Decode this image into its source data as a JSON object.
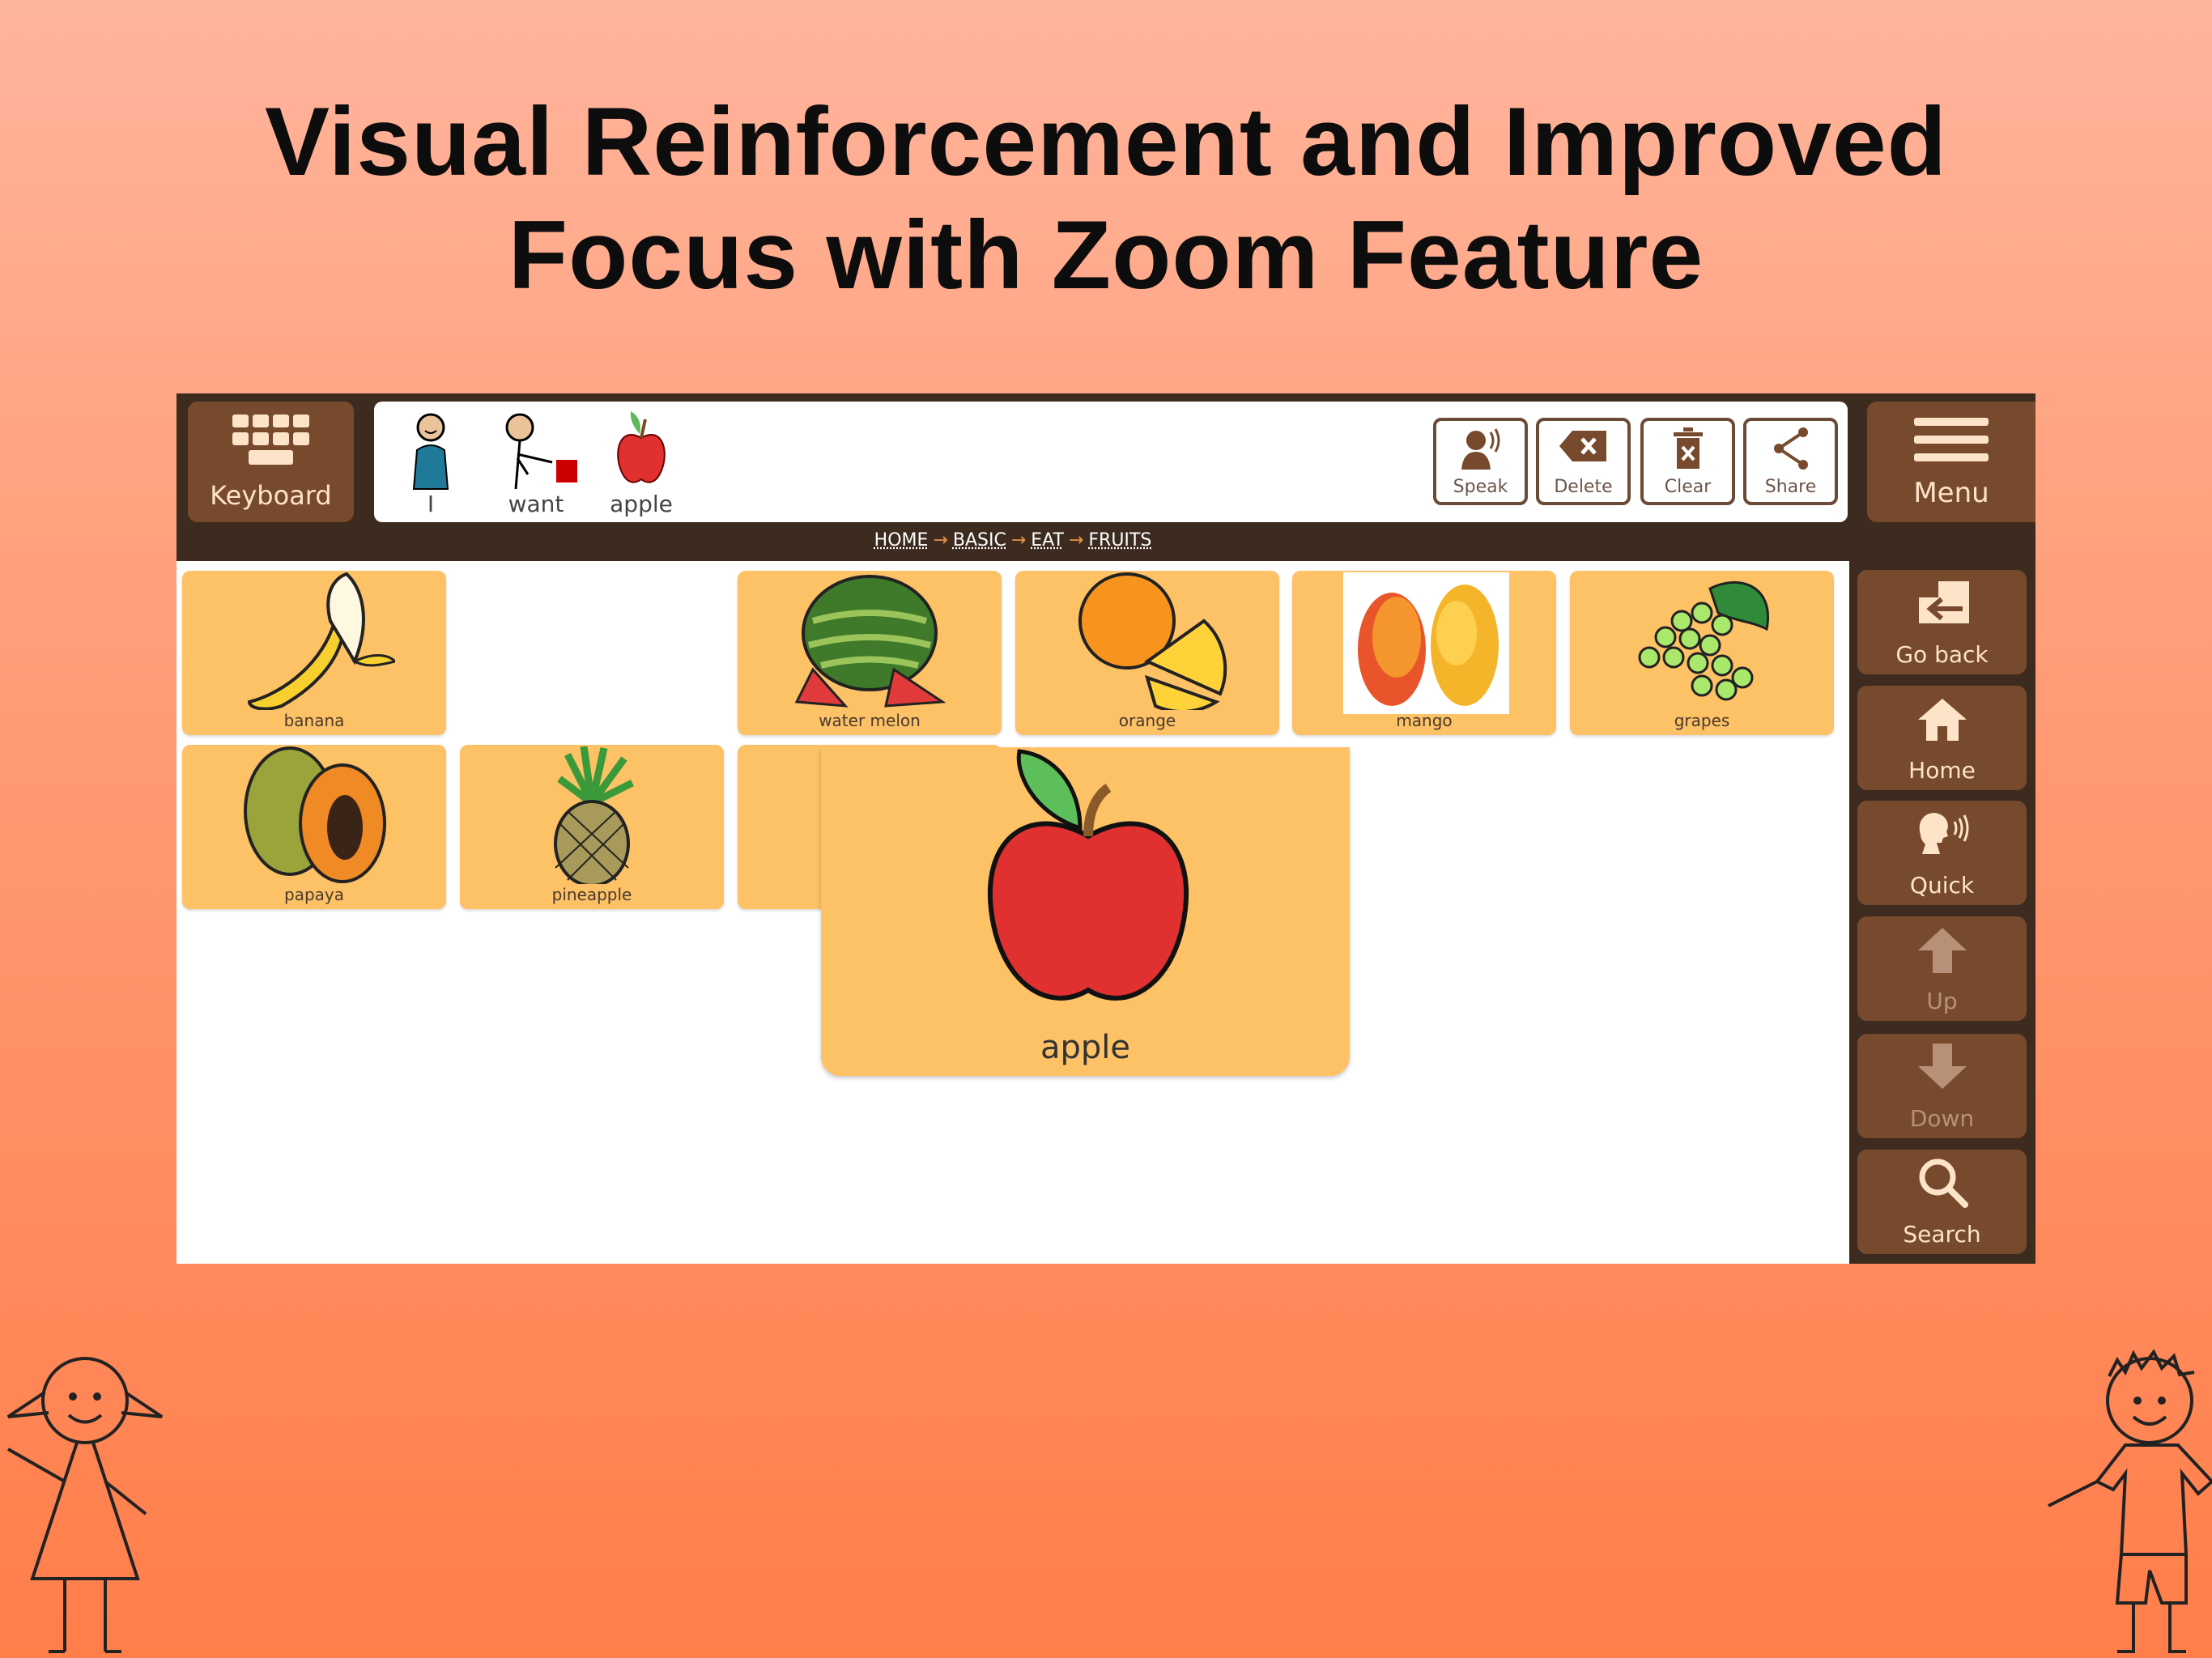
{
  "headline": {
    "line1": "Visual Reinforcement and Improved",
    "line2": "Focus with Zoom Feature"
  },
  "toolbar": {
    "keyboard_label": "Keyboard",
    "sentence": [
      {
        "label": "I",
        "icon": "person-me-icon"
      },
      {
        "label": "want",
        "icon": "person-want-icon"
      },
      {
        "label": "apple",
        "icon": "apple-icon"
      }
    ],
    "actions": [
      {
        "label": "Speak",
        "icon": "speak-icon"
      },
      {
        "label": "Delete",
        "icon": "backspace-icon"
      },
      {
        "label": "Clear",
        "icon": "trash-icon"
      },
      {
        "label": "Share",
        "icon": "share-icon"
      }
    ],
    "menu_label": "Menu"
  },
  "breadcrumb": [
    "HOME",
    "BASIC",
    "EAT",
    "FRUITS"
  ],
  "breadcrumb_sep": "→",
  "tiles": [
    {
      "label": "banana"
    },
    {
      "label": "water melon"
    },
    {
      "label": "orange"
    },
    {
      "label": "mango"
    },
    {
      "label": "grapes"
    },
    {
      "label": "papaya"
    },
    {
      "label": "pineapple"
    }
  ],
  "zoomed_tile": {
    "label": "apple"
  },
  "sidebar": [
    {
      "label": "Go back",
      "icon": "go-back-icon"
    },
    {
      "label": "Home",
      "icon": "home-icon"
    },
    {
      "label": "Quick",
      "icon": "quick-speak-icon"
    },
    {
      "label": "Up",
      "icon": "arrow-up-icon",
      "disabled": true
    },
    {
      "label": "Down",
      "icon": "arrow-down-icon",
      "disabled": true
    },
    {
      "label": "Search",
      "icon": "search-icon"
    }
  ],
  "colors": {
    "frame": "#3d2b1f",
    "button": "#774a2d",
    "button_text": "#fde3c8",
    "tile": "#fdc166"
  }
}
